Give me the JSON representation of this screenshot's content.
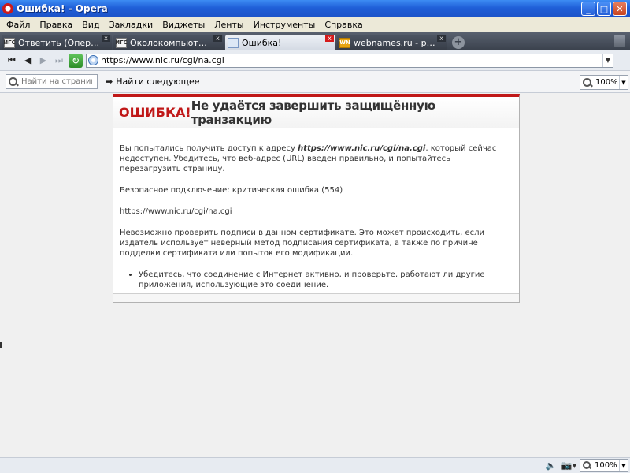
{
  "window": {
    "title": "Ошибка! - Opera",
    "minimize_glyph": "_",
    "maximize_glyph": "□",
    "close_glyph": "✕"
  },
  "menu": {
    "items": [
      "Файл",
      "Правка",
      "Вид",
      "Закладки",
      "Виджеты",
      "Ленты",
      "Инструменты",
      "Справка"
    ]
  },
  "tabs": [
    {
      "favicon_text": "ИГС",
      "label": "Ответить (Операцион...",
      "active": false
    },
    {
      "favicon_text": "ИГС",
      "label": "Околокомпьютерные ...",
      "active": false
    },
    {
      "favicon_text": "",
      "label": "Ошибка!",
      "active": true
    },
    {
      "favicon_text": "WN",
      "label": "webnames.ru - регистр...",
      "active": false
    }
  ],
  "tab_close_glyph": "x",
  "new_tab_glyph": "+",
  "address_bar": {
    "url": "https://www.nic.ru/cgi/na.cgi",
    "back_glyph": "⏮",
    "back_one_glyph": "◀",
    "forward_glyph": "▶",
    "fastforward_glyph": "⏭",
    "reload_glyph": "↻",
    "dropdown_glyph": "▼"
  },
  "find_bar": {
    "placeholder": "Найти на странице",
    "find_next_label": "Найти следующее",
    "find_next_glyph": "➡",
    "zoom": "100%"
  },
  "error_page": {
    "label": "ОШИБКА!",
    "title": "Не удаётся завершить защищённую транзакцию",
    "paragraph1_before": "Вы попытались получить доступ к адресу ",
    "paragraph1_url": "https://www.nic.ru/cgi/na.cgi",
    "paragraph1_after": ", который сейчас недоступен. Убедитесь, что веб-адрес (URL) введен правильно, и попытайтесь перезагрузить страницу.",
    "secure_status": "Безопасное подключение: критическая ошибка (554)",
    "url_plain": "https://www.nic.ru/cgi/na.cgi",
    "certificate_note": "Невозможно проверить подписи в данном сертификате. Это может происходить, если издатель использует неверный метод подписания сертификата, а также по причине подделки сертификата или попыток его модификации.",
    "bullet": "Убедитесь, что соединение с Интернет активно, и проверьте, работают ли другие приложения, использующие это соединение."
  },
  "status_bar": {
    "zoom": "100%",
    "dropdown_glyph": "▼",
    "speaker_glyph": "🔈",
    "camera_glyph": "📷"
  },
  "colors": {
    "accent": "#c01818",
    "titlebar": "#1f5fd8",
    "tabbar": "#3a414c"
  }
}
